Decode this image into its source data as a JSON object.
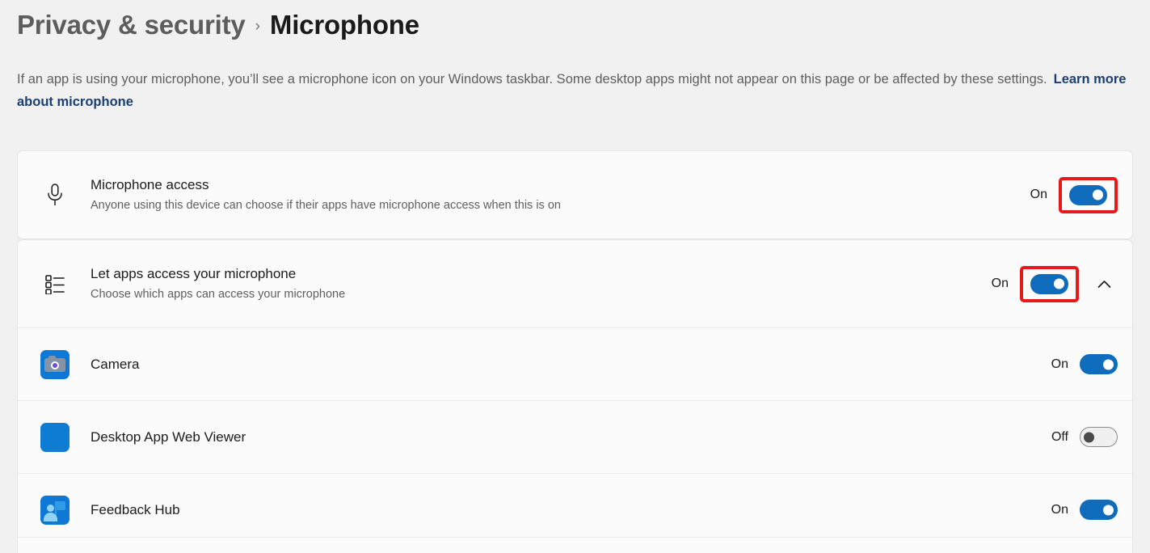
{
  "breadcrumb": {
    "parent": "Privacy & security",
    "separator": "›",
    "current": "Microphone"
  },
  "description": {
    "text": "If an app is using your microphone, you’ll see a microphone icon on your Windows taskbar. Some desktop apps might not appear on this page or be affected by these settings.",
    "link_label": "Learn more about microphone",
    "link_color": "#1b3f74"
  },
  "colors": {
    "page_background": "#f1f1f1",
    "card_background": "#fbfbfb",
    "toggle_on": "#0f6cbd",
    "toggle_off_track": "#f0f0f0",
    "highlight_red": "#e8191b"
  },
  "microphone_access": {
    "icon": "microphone-icon",
    "title": "Microphone access",
    "subtitle": "Anyone using this device can choose if their apps have microphone access when this is on",
    "state_label": "On",
    "toggle_state": "on",
    "highlighted": true
  },
  "let_apps_access": {
    "icon": "list-icon",
    "title": "Let apps access your microphone",
    "subtitle": "Choose which apps can access your microphone",
    "state_label": "On",
    "toggle_state": "on",
    "highlighted": true,
    "expander": "chevron-up-icon"
  },
  "apps": [
    {
      "name": "Camera",
      "icon": "camera-app-icon",
      "state_label": "On",
      "toggle_state": "on"
    },
    {
      "name": "Desktop App Web Viewer",
      "icon": "desktop-app-web-viewer-icon",
      "state_label": "Off",
      "toggle_state": "off"
    },
    {
      "name": "Feedback Hub",
      "icon": "feedback-hub-icon",
      "state_label": "On",
      "toggle_state": "on"
    }
  ]
}
